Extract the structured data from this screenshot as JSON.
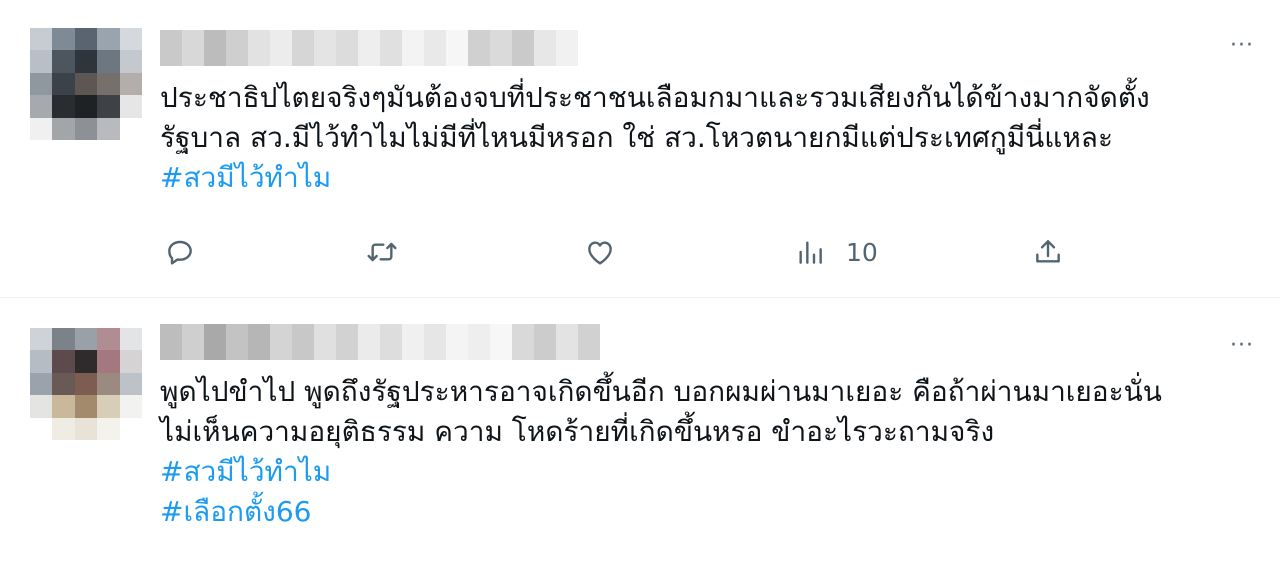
{
  "tweets": [
    {
      "body_lines": [
        "ประชาธิปไตยจริงๆมันต้องจบที่ประชาชนเลือมกมาและรวมเสียงกันได้ข้างมากจัดตั้ง",
        "รัฐบาล สว.มีไว้ทำไมไม่มีที่ไหนมีหรอก ใช่ สว.โหวตนายกมีแต่ประเทศกูมีนี่แหละ"
      ],
      "hashtags": [
        "#สวมีไว้ทำไม"
      ],
      "actions": {
        "reply_icon": "reply-icon",
        "retweet_icon": "retweet-icon",
        "like_icon": "like-icon",
        "views_icon": "views-icon",
        "views_count": "10",
        "share_icon": "share-icon"
      },
      "more_label": "···"
    },
    {
      "body_lines": [
        "พูดไปขำไป พูดถึงรัฐประหารอาจเกิดขึ้นอีก บอกผมผ่านมาเยอะ คือถ้าผ่านมาเยอะนั่น",
        "ไม่เห็นความอยุติธรรม ความ โหดร้ายที่เกิดขึ้นหรอ ขำอะไรวะถามจริง"
      ],
      "hashtags": [
        "#สวมีไว้ทำไม",
        "#เลือกตั้ง66"
      ],
      "more_label": "···"
    }
  ],
  "colors": {
    "text": "#0f1419",
    "secondary": "#536471",
    "link": "#1d9bf0",
    "divider": "#eff3f4"
  }
}
